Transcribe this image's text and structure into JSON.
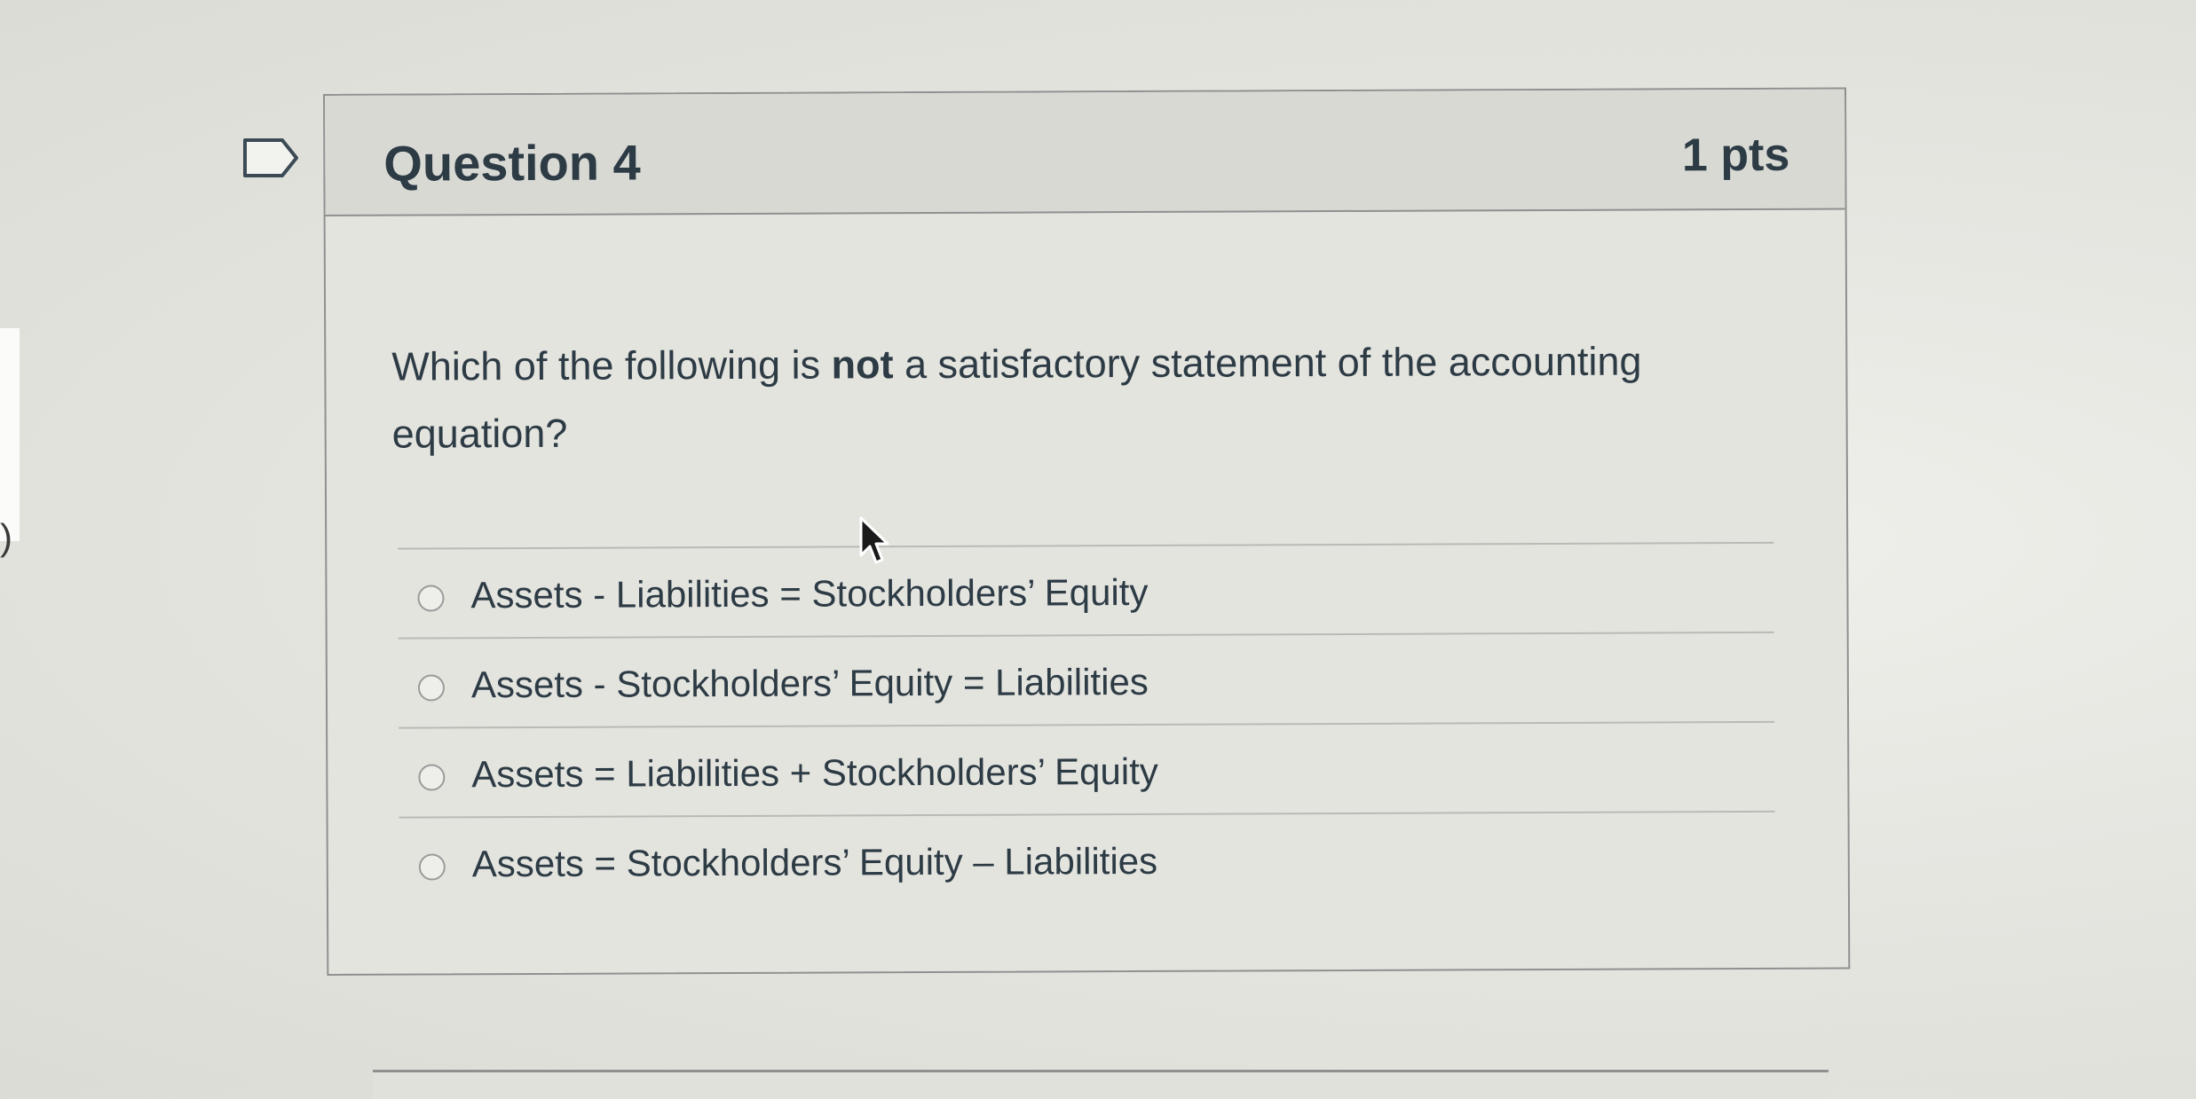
{
  "question": {
    "title": "Question 4",
    "points": "1 pts",
    "text_before": "Which of the following is ",
    "text_bold": "not",
    "text_after": " a satisfactory statement of the accounting equation?"
  },
  "answers": [
    {
      "label": "Assets - Liabilities = Stockholders’ Equity",
      "selected": false
    },
    {
      "label": "Assets - Stockholders’ Equity = Liabilities",
      "selected": false
    },
    {
      "label": "Assets = Liabilities + Stockholders’ Equity",
      "selected": false
    },
    {
      "label": "Assets = Stockholders’ Equity – Liabilities",
      "selected": false
    }
  ],
  "left_edge": {
    "text": ")"
  },
  "icons": {
    "flag": "flag-icon",
    "cursor": "mouse-cursor-icon"
  },
  "colors": {
    "text": "#2d3b45",
    "header_bg": "#d9d9d4",
    "card_bg": "#e4e4df",
    "border": "#8f9190"
  }
}
